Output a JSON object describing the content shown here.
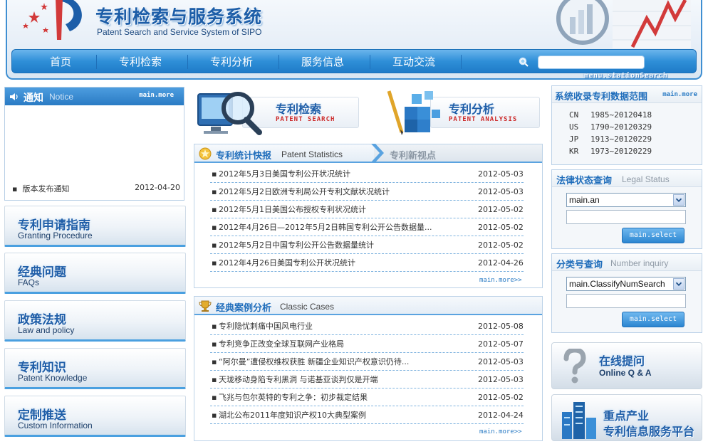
{
  "header": {
    "title_cn": "专利检索与服务系统",
    "title_en": "Patent Search and Service System of SIPO"
  },
  "nav": {
    "items": [
      "首页",
      "专利检索",
      "专利分析",
      "服务信息",
      "互动交流"
    ],
    "search_label": "menu.stationSearch",
    "search_value": ""
  },
  "notice": {
    "title_cn": "通知",
    "title_en": "Notice",
    "more": "main.more",
    "items": [
      {
        "title": "版本发布通知",
        "date": "2012-04-20"
      }
    ]
  },
  "left_buttons": [
    {
      "cn": "专利申请指南",
      "en": "Granting Procedure"
    },
    {
      "cn": "经典问题",
      "en": "FAQs"
    },
    {
      "cn": "政策法规",
      "en": "Law and policy"
    },
    {
      "cn": "专利知识",
      "en": "Patent Knowledge"
    },
    {
      "cn": "定制推送",
      "en": "Custom Information"
    }
  ],
  "features": [
    {
      "cn": "专利检索",
      "en": "PATENT SEARCH"
    },
    {
      "cn": "专利分析",
      "en": "PATENT ANALYSIS"
    }
  ],
  "stats": {
    "title_cn": "专利统计快报",
    "title_en": "Patent Statistics",
    "tab2": "专利新视点",
    "more": "main.more>>",
    "items": [
      {
        "title": "2012年5月3日美国专利公开状况统计",
        "date": "2012-05-03"
      },
      {
        "title": "2012年5月2日欧洲专利局公开专利文献状况统计",
        "date": "2012-05-03"
      },
      {
        "title": "2012年5月1日美国公布授权专利状况统计",
        "date": "2012-05-02"
      },
      {
        "title": "2012年4月26日—2012年5月2日韩国专利公开公告数据量...",
        "date": "2012-05-02"
      },
      {
        "title": "2012年5月2日中国专利公开公告数据量统计",
        "date": "2012-05-02"
      },
      {
        "title": "2012年4月26日美国专利公开状况统计",
        "date": "2012-04-26"
      }
    ]
  },
  "cases": {
    "title_cn": "经典案例分析",
    "title_en": "Classic Cases",
    "more": "main.more>>",
    "items": [
      {
        "title": "专利隐忧刺痛中国风电行业",
        "date": "2012-05-08"
      },
      {
        "title": "专利竞争正改变全球互联网产业格局",
        "date": "2012-05-07"
      },
      {
        "title": "“阿尔曼”遭侵权维权获胜 新疆企业知识产权意识仍待...",
        "date": "2012-05-03"
      },
      {
        "title": "天珑移动身陷专利黑洞 与诺基亚谈判仅是开端",
        "date": "2012-05-03"
      },
      {
        "title": "飞兆与包尔英特的专利之争：初步裁定结果",
        "date": "2012-05-02"
      },
      {
        "title": "湖北公布2011年度知识产权10大典型案例",
        "date": "2012-04-24"
      }
    ]
  },
  "coverage": {
    "title_cn": "系统收录专利数据范围",
    "more": "main.more",
    "rows": [
      {
        "cc": "CN",
        "range": "1985~20120418"
      },
      {
        "cc": "US",
        "range": "1790~20120329"
      },
      {
        "cc": "JP",
        "range": "1913~20120229"
      },
      {
        "cc": "KR",
        "range": "1973~20120229"
      }
    ]
  },
  "legal_status": {
    "title_cn": "法律状态查询",
    "title_en": "Legal Status",
    "select_value": "main.an",
    "input_value": "",
    "button": "main.select"
  },
  "classify": {
    "title_cn": "分类号查询",
    "title_en": "Number inquiry",
    "select_value": "main.ClassifyNumSearch",
    "input_value": "",
    "button": "main.select"
  },
  "promos": [
    {
      "cn": "在线提问",
      "en": "Online Q & A"
    },
    {
      "cn": "重点产业",
      "cn2": "专利信息服务平台"
    }
  ],
  "colors": {
    "brand_blue": "#2a7bc4",
    "accent_red": "#cc2a2a"
  }
}
